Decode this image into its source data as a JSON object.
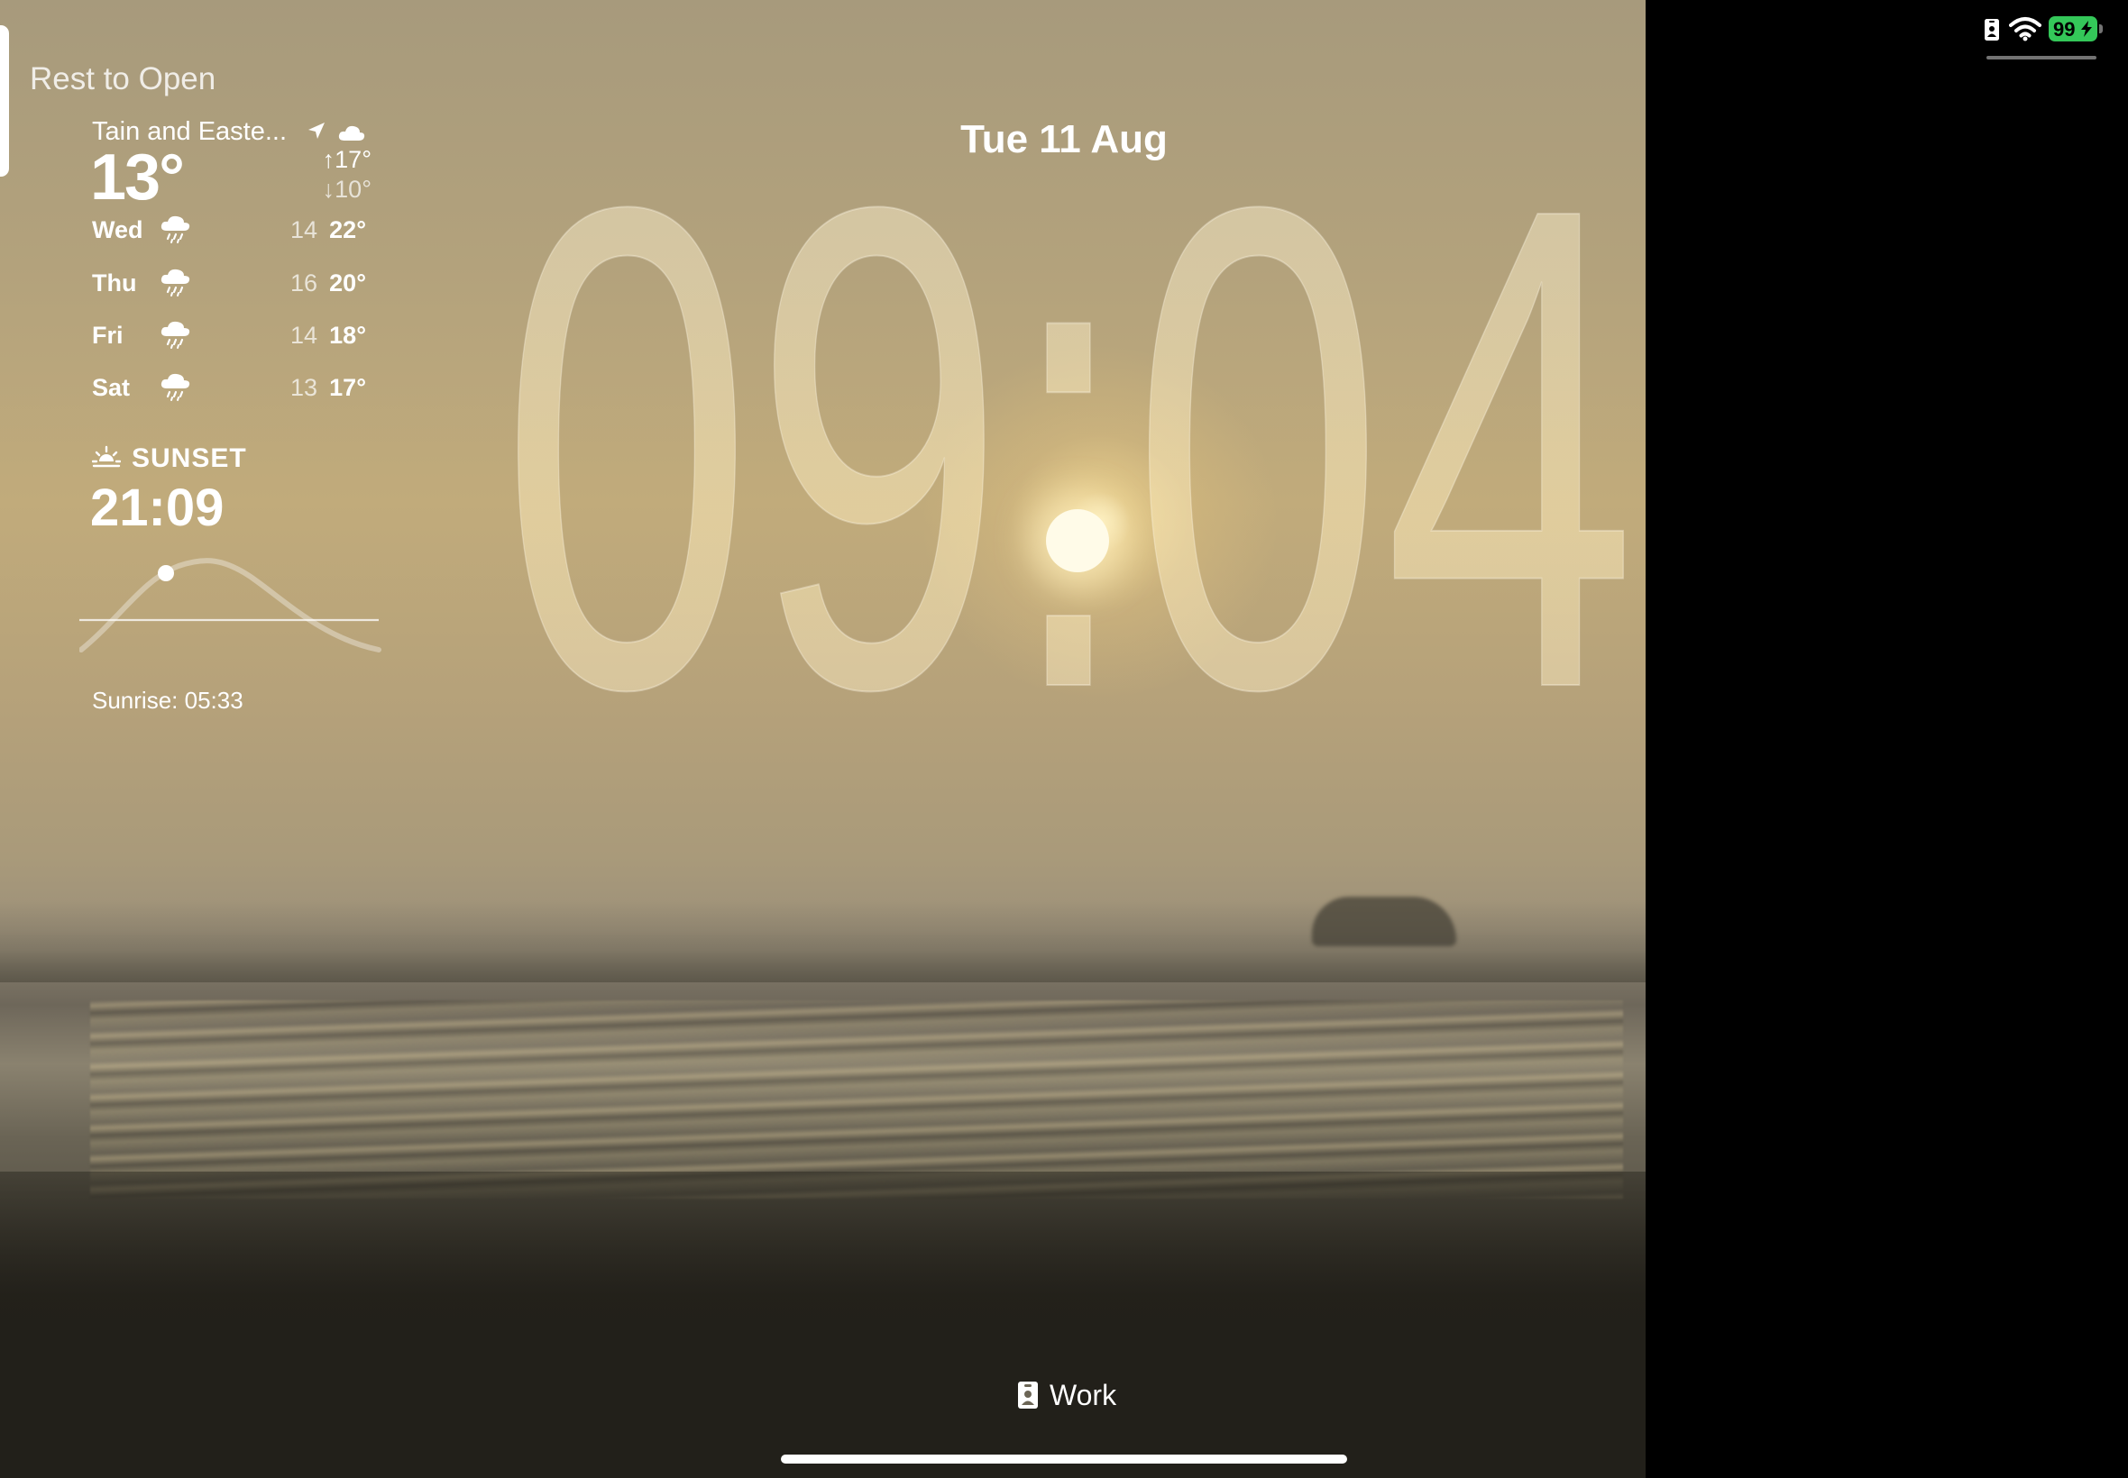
{
  "lock_screen": {
    "hint": "Rest to Open",
    "date": "Tue 11 Aug",
    "time": "09:04",
    "focus_mode": "Work"
  },
  "weather": {
    "location": "Tain and Easte...",
    "current_temp": "13°",
    "high": "↑17°",
    "low": "↓10°",
    "condition_icon": "cloud-icon",
    "forecast": [
      {
        "day": "Wed",
        "icon": "cloud-rain-icon",
        "low": "14",
        "high": "22°"
      },
      {
        "day": "Thu",
        "icon": "cloud-rain-icon",
        "low": "16",
        "high": "20°"
      },
      {
        "day": "Fri",
        "icon": "cloud-rain-icon",
        "low": "14",
        "high": "18°"
      },
      {
        "day": "Sat",
        "icon": "cloud-rain-icon",
        "low": "13",
        "high": "17°"
      }
    ]
  },
  "sunset": {
    "label": "SUNSET",
    "time": "21:09",
    "sunrise": "Sunrise: 05:33"
  },
  "status_bar": {
    "battery_level": "99",
    "battery_color": "#34c759",
    "charging": true
  }
}
